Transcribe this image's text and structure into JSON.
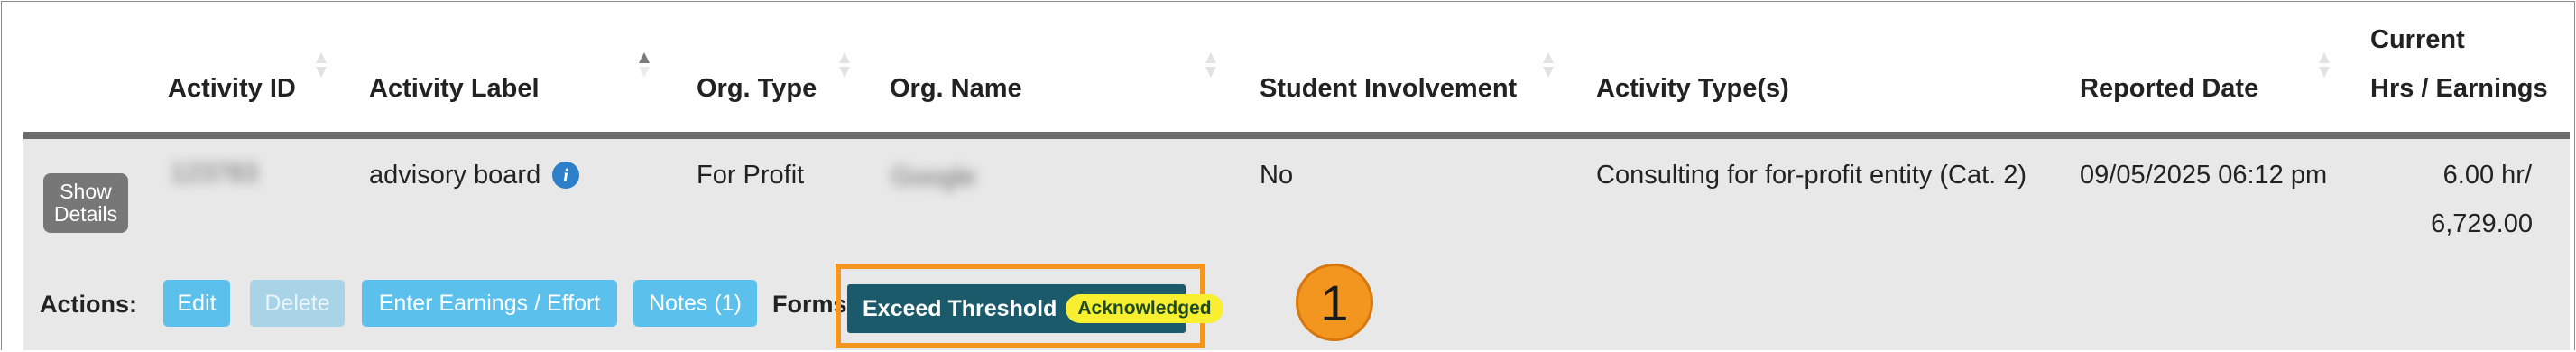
{
  "table": {
    "columns": {
      "activity_id": "Activity ID",
      "activity_label": "Activity Label",
      "org_type": "Org. Type",
      "org_name": "Org. Name",
      "student_involvement": "Student Involvement",
      "activity_types": "Activity Type(s)",
      "reported_date": "Reported Date",
      "current_line1": "Current",
      "current_line2": "Hrs / Earnings"
    },
    "sorted_column": "Activity Label",
    "sort_direction": "ascending",
    "row": {
      "show_details_label": "Show\nDetails",
      "activity_id": "123783",
      "activity_label": "advisory board",
      "org_type": "For Profit",
      "org_name": "Google",
      "student_involvement": "No",
      "activity_types": "Consulting for for-profit entity (Cat. 2)",
      "reported_date": "09/05/2025 06:12 pm",
      "hours": "6.00 hr/",
      "earnings": "6,729.00"
    }
  },
  "actions": {
    "label": "Actions:",
    "buttons": {
      "edit": "Edit",
      "delete": "Delete",
      "enter_earnings": "Enter Earnings / Effort",
      "notes": "Notes (1)"
    }
  },
  "forms": {
    "label": "Forms",
    "exceed_threshold": "Exceed Threshold",
    "status_badge": "Acknowledged"
  },
  "callout": {
    "number": "1"
  },
  "colors": {
    "header_rule": "#6b6b6b",
    "row_background": "#e8e8e8",
    "action_button": "#5bc0eb",
    "action_button_disabled": "#a9d3e6",
    "threshold_button": "#1a5a6b",
    "badge": "#f7ef2f",
    "highlight_frame": "#f4951e",
    "callout": "#f2961f",
    "info_icon": "#2e7fc9"
  },
  "icons": {
    "sort": "sort-arrows-icon",
    "info": "info-circle-icon"
  }
}
